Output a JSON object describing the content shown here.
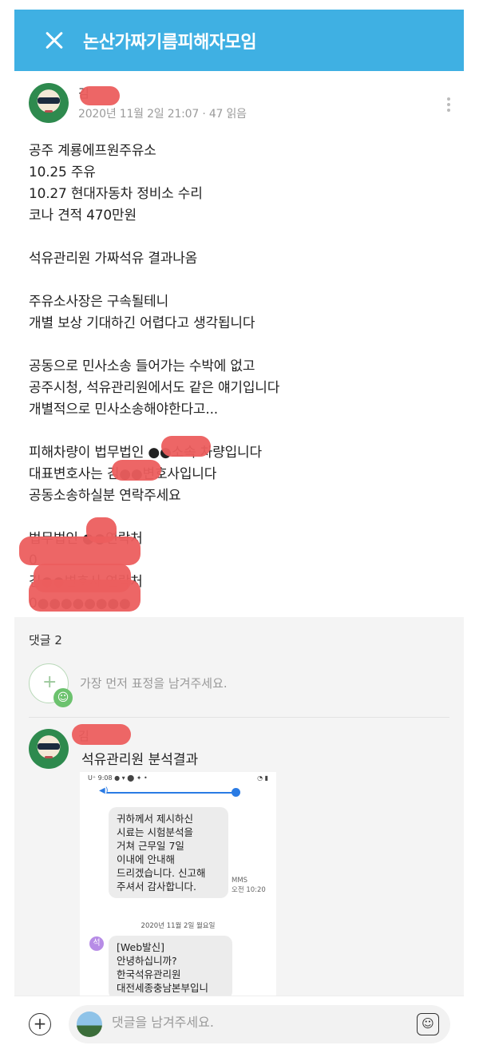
{
  "header": {
    "title": "논산가짜기름피해자모임"
  },
  "post": {
    "author_visible": "김",
    "meta": "2020년 11월 2일 21:07 · 47 읽음",
    "paragraphs": [
      [
        "공주 계룡에프원주유소",
        "10.25 주유",
        "10.27 현대자동차 정비소 수리",
        "코나 견적 470만원"
      ],
      [
        "석유관리원 가짜석유 결과나옴"
      ],
      [
        "주유소사장은 구속될테니",
        "개별 보상 기대하긴 어렵다고  생각됩니다"
      ],
      [
        "공동으로 민사소송 들어가는 수박에 없고",
        "공주시청, 석유관리원에서도 같은 얘기입니다",
        "개별적으로 민사소송해야한다고..."
      ],
      [
        "피해차량이 법무법인 ●●소속 차량입니다",
        "대표변호사는 김●●변호사입니다",
        "공동소송하실분 연락주세요"
      ],
      [
        "법무법인 ●●연락처",
        "0",
        "김●●변호사 연락처",
        "0●●●●●●●●"
      ]
    ]
  },
  "comments": {
    "count_label": "댓글 2",
    "emoji_hint": "가장 먼저 표정을 남겨주세요.",
    "items": [
      {
        "author": "김",
        "text": "석유관리원 분석결과",
        "attachment": {
          "status_left": "U⁺ 9:08 ● ▾ ⬤ ✦ •",
          "status_right": "◔ ▮",
          "message1": "귀하께서 제시하신\n시료는 시험분석을\n거쳐 근무일 7일\n이내에 안내해\n드리겠습니다. 신고해\n주셔서 감사합니다.",
          "message1_type": "MMS",
          "message1_time": "오전 10:20",
          "date_divider": "2020년 11월 2일 월요일",
          "sender_initial": "석",
          "message2": "[Web발신]\n안녕하십니까?\n한국석유관리원\n대전세종충남본부입니"
        }
      }
    ]
  },
  "composer": {
    "placeholder": "댓글을 남겨주세요."
  },
  "colors": {
    "header_bg": "#3fb0e3",
    "redaction": "#ec5e5e"
  }
}
